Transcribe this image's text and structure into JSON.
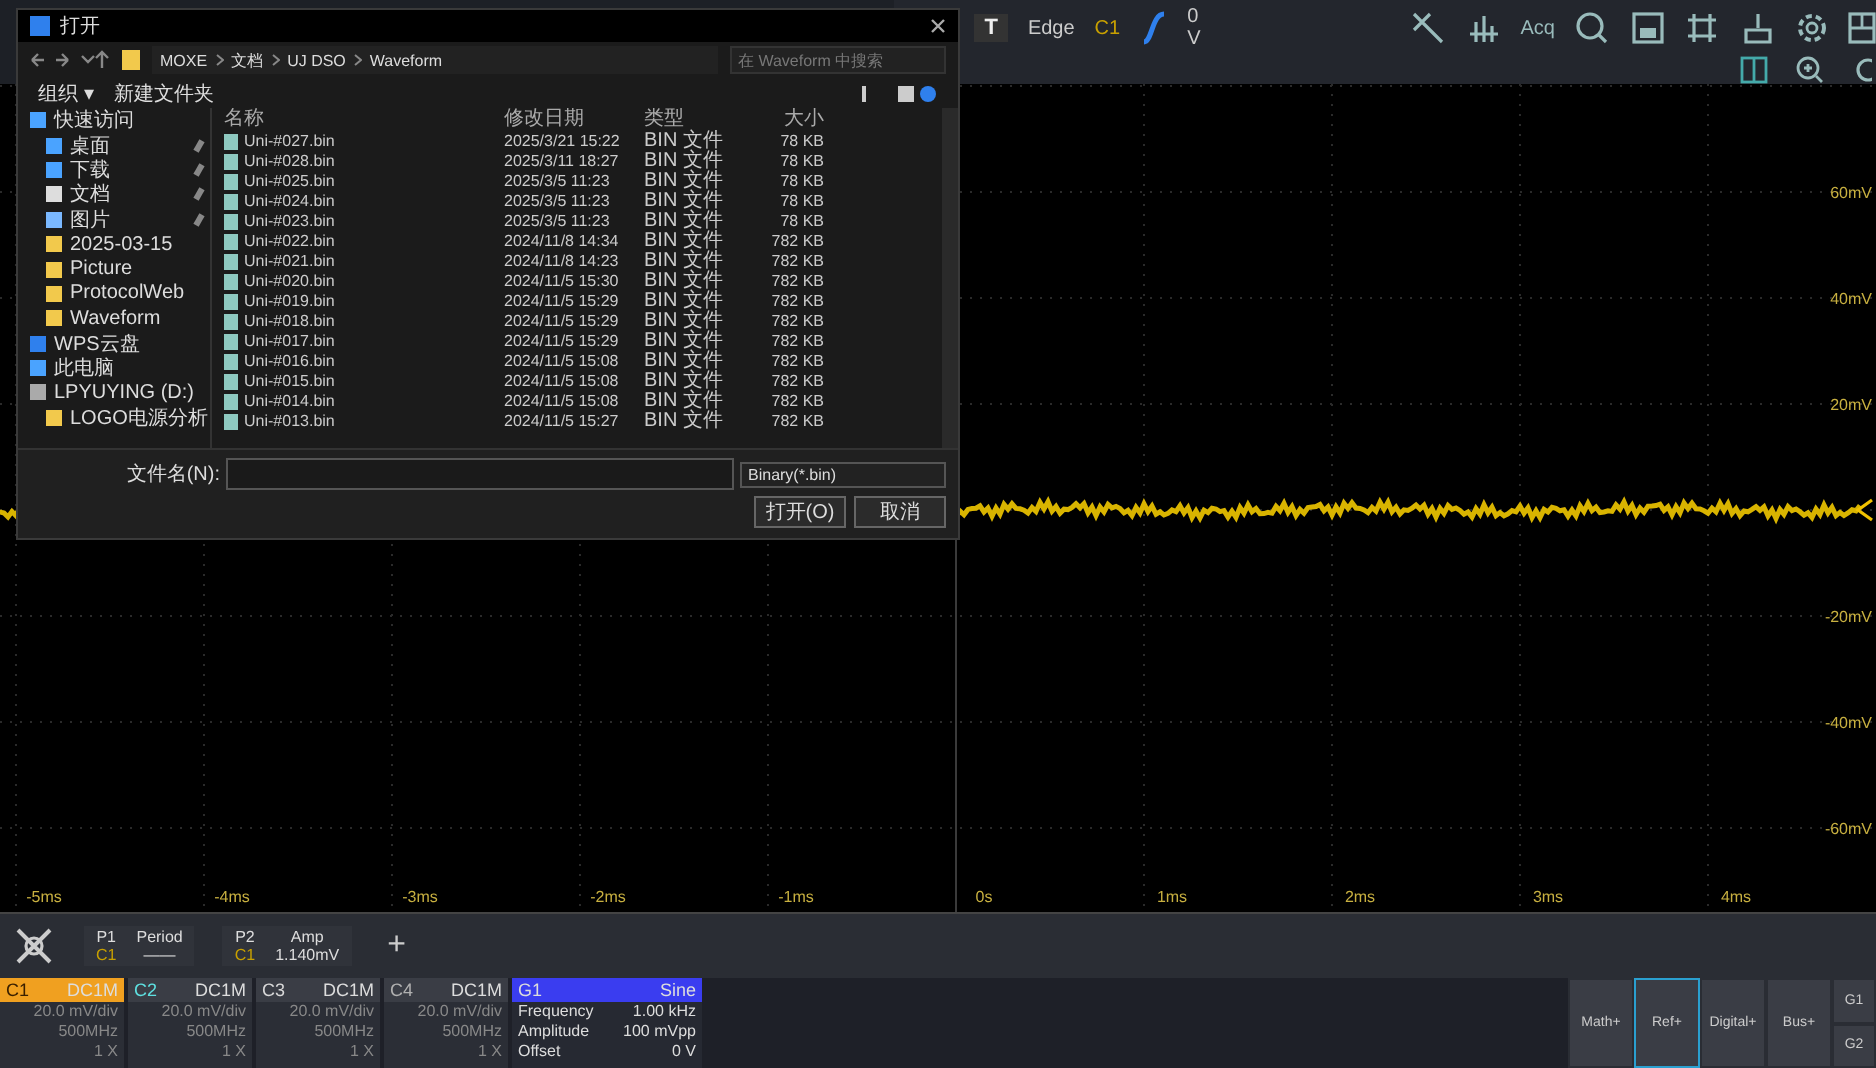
{
  "toolbar": {
    "trigger_button": "T",
    "trigger_type": "Edge",
    "trigger_source": "C1",
    "trigger_level": "0 V",
    "acq": "Acq"
  },
  "plot": {
    "y_labels": [
      "60mV",
      "40mV",
      "20mV",
      "-20mV",
      "-40mV",
      "-60mV"
    ],
    "x_labels": [
      "-5ms",
      "-4ms",
      "-3ms",
      "-2ms",
      "-1ms",
      "0s",
      "1ms",
      "2ms",
      "3ms",
      "4ms"
    ]
  },
  "dialog": {
    "title": "打开",
    "breadcrumb": [
      "MOXE",
      "文档",
      "UJ DSO",
      "Waveform"
    ],
    "search_placeholder": "在 Waveform 中搜索",
    "organize": "组织 ▾",
    "new_folder": "新建文件夹",
    "sidebar": [
      {
        "label": "快速访问",
        "kind": "star",
        "children": [
          {
            "label": "桌面",
            "kind": "desktop",
            "pinned": true
          },
          {
            "label": "下载",
            "kind": "download",
            "pinned": true
          },
          {
            "label": "文档",
            "kind": "doc",
            "pinned": true
          },
          {
            "label": "图片",
            "kind": "picture",
            "pinned": true
          },
          {
            "label": "2025-03-15",
            "kind": "folder",
            "pinned": false
          },
          {
            "label": "Picture",
            "kind": "folder",
            "pinned": false
          },
          {
            "label": "ProtocolWeb",
            "kind": "folder",
            "pinned": false
          },
          {
            "label": "Waveform",
            "kind": "folder",
            "pinned": false
          }
        ]
      },
      {
        "label": "WPS云盘",
        "kind": "cloud"
      },
      {
        "label": "此电脑",
        "kind": "pc"
      },
      {
        "label": "LPYUYING (D:)",
        "kind": "drive",
        "children": [
          {
            "label": "LOGO电源分析",
            "kind": "folder"
          }
        ]
      }
    ],
    "columns": [
      "名称",
      "修改日期",
      "类型",
      "大小"
    ],
    "files": [
      [
        "Uni-#027.bin",
        "2025/3/21 15:22",
        "BIN 文件",
        "78 KB"
      ],
      [
        "Uni-#028.bin",
        "2025/3/11 18:27",
        "BIN 文件",
        "78 KB"
      ],
      [
        "Uni-#025.bin",
        "2025/3/5 11:23",
        "BIN 文件",
        "78 KB"
      ],
      [
        "Uni-#024.bin",
        "2025/3/5 11:23",
        "BIN 文件",
        "78 KB"
      ],
      [
        "Uni-#023.bin",
        "2025/3/5 11:23",
        "BIN 文件",
        "78 KB"
      ],
      [
        "Uni-#022.bin",
        "2024/11/8 14:34",
        "BIN 文件",
        "782 KB"
      ],
      [
        "Uni-#021.bin",
        "2024/11/8 14:23",
        "BIN 文件",
        "782 KB"
      ],
      [
        "Uni-#020.bin",
        "2024/11/5 15:30",
        "BIN 文件",
        "782 KB"
      ],
      [
        "Uni-#019.bin",
        "2024/11/5 15:29",
        "BIN 文件",
        "782 KB"
      ],
      [
        "Uni-#018.bin",
        "2024/11/5 15:29",
        "BIN 文件",
        "782 KB"
      ],
      [
        "Uni-#017.bin",
        "2024/11/5 15:29",
        "BIN 文件",
        "782 KB"
      ],
      [
        "Uni-#016.bin",
        "2024/11/5 15:08",
        "BIN 文件",
        "782 KB"
      ],
      [
        "Uni-#015.bin",
        "2024/11/5 15:08",
        "BIN 文件",
        "782 KB"
      ],
      [
        "Uni-#014.bin",
        "2024/11/5 15:08",
        "BIN 文件",
        "782 KB"
      ],
      [
        "Uni-#013.bin",
        "2024/11/5 15:27",
        "BIN 文件",
        "782 KB"
      ]
    ],
    "filename_label": "文件名(N):",
    "filetype": "Binary(*.bin)",
    "buttons": [
      "打开(O)",
      "取消"
    ]
  },
  "measurements": [
    {
      "id": "P1",
      "channel": "C1",
      "name": "Period",
      "value": "——"
    },
    {
      "id": "P2",
      "channel": "C1",
      "name": "Amp",
      "value": "1.140mV"
    }
  ],
  "add_button": "+",
  "channels": [
    {
      "name": "C1",
      "coupling": "DC1M",
      "scale": "20.0 mV/div",
      "bandwidth": "500MHz",
      "probe": "1 X",
      "selected": true,
      "color": "#f0a020"
    },
    {
      "name": "C2",
      "coupling": "DC1M",
      "scale": "20.0 mV/div",
      "bandwidth": "500MHz",
      "probe": "1 X",
      "selected": false,
      "color": "#5ee0e0"
    },
    {
      "name": "C3",
      "coupling": "DC1M",
      "scale": "20.0 mV/div",
      "bandwidth": "500MHz",
      "probe": "1 X",
      "selected": false,
      "color": "#d8d8d8"
    },
    {
      "name": "C4",
      "coupling": "DC1M",
      "scale": "20.0 mV/div",
      "bandwidth": "500MHz",
      "probe": "1 X",
      "selected": false,
      "color": "#b0b0b0"
    }
  ],
  "generator": {
    "name": "G1",
    "wave": "Sine",
    "params": [
      [
        "Frequency",
        "1.00 kHz"
      ],
      [
        "Amplitude",
        "100 mVpp"
      ],
      [
        "Offset",
        "0 V"
      ]
    ]
  },
  "menu_buttons": [
    {
      "label": "Math+",
      "selected": false
    },
    {
      "label": "Ref+",
      "selected": true
    },
    {
      "label": "Digital+",
      "selected": false
    },
    {
      "label": "Bus+",
      "selected": false
    }
  ],
  "side_buttons": [
    "G1",
    "G2"
  ]
}
